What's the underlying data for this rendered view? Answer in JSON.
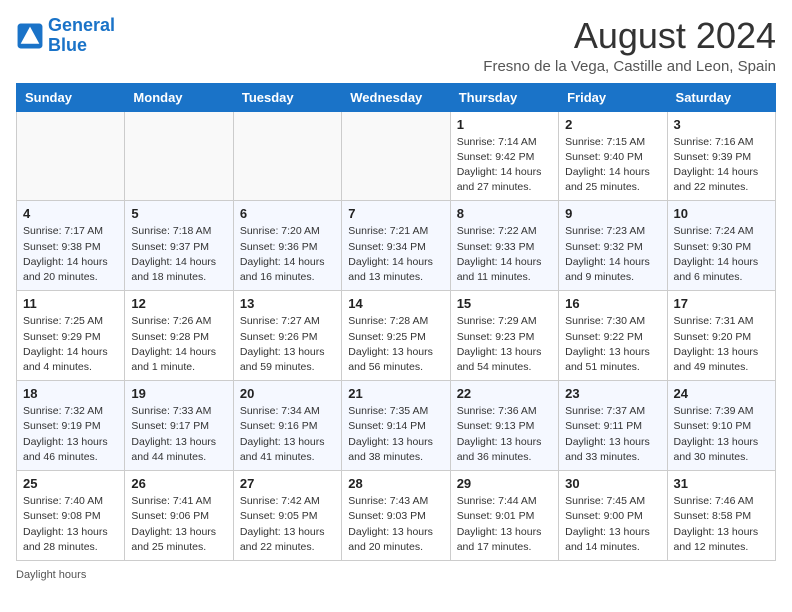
{
  "header": {
    "logo_line1": "General",
    "logo_line2": "Blue",
    "month_year": "August 2024",
    "location": "Fresno de la Vega, Castille and Leon, Spain"
  },
  "days_of_week": [
    "Sunday",
    "Monday",
    "Tuesday",
    "Wednesday",
    "Thursday",
    "Friday",
    "Saturday"
  ],
  "weeks": [
    [
      {
        "day": "",
        "info": ""
      },
      {
        "day": "",
        "info": ""
      },
      {
        "day": "",
        "info": ""
      },
      {
        "day": "",
        "info": ""
      },
      {
        "day": "1",
        "info": "Sunrise: 7:14 AM\nSunset: 9:42 PM\nDaylight: 14 hours and 27 minutes."
      },
      {
        "day": "2",
        "info": "Sunrise: 7:15 AM\nSunset: 9:40 PM\nDaylight: 14 hours and 25 minutes."
      },
      {
        "day": "3",
        "info": "Sunrise: 7:16 AM\nSunset: 9:39 PM\nDaylight: 14 hours and 22 minutes."
      }
    ],
    [
      {
        "day": "4",
        "info": "Sunrise: 7:17 AM\nSunset: 9:38 PM\nDaylight: 14 hours and 20 minutes."
      },
      {
        "day": "5",
        "info": "Sunrise: 7:18 AM\nSunset: 9:37 PM\nDaylight: 14 hours and 18 minutes."
      },
      {
        "day": "6",
        "info": "Sunrise: 7:20 AM\nSunset: 9:36 PM\nDaylight: 14 hours and 16 minutes."
      },
      {
        "day": "7",
        "info": "Sunrise: 7:21 AM\nSunset: 9:34 PM\nDaylight: 14 hours and 13 minutes."
      },
      {
        "day": "8",
        "info": "Sunrise: 7:22 AM\nSunset: 9:33 PM\nDaylight: 14 hours and 11 minutes."
      },
      {
        "day": "9",
        "info": "Sunrise: 7:23 AM\nSunset: 9:32 PM\nDaylight: 14 hours and 9 minutes."
      },
      {
        "day": "10",
        "info": "Sunrise: 7:24 AM\nSunset: 9:30 PM\nDaylight: 14 hours and 6 minutes."
      }
    ],
    [
      {
        "day": "11",
        "info": "Sunrise: 7:25 AM\nSunset: 9:29 PM\nDaylight: 14 hours and 4 minutes."
      },
      {
        "day": "12",
        "info": "Sunrise: 7:26 AM\nSunset: 9:28 PM\nDaylight: 14 hours and 1 minute."
      },
      {
        "day": "13",
        "info": "Sunrise: 7:27 AM\nSunset: 9:26 PM\nDaylight: 13 hours and 59 minutes."
      },
      {
        "day": "14",
        "info": "Sunrise: 7:28 AM\nSunset: 9:25 PM\nDaylight: 13 hours and 56 minutes."
      },
      {
        "day": "15",
        "info": "Sunrise: 7:29 AM\nSunset: 9:23 PM\nDaylight: 13 hours and 54 minutes."
      },
      {
        "day": "16",
        "info": "Sunrise: 7:30 AM\nSunset: 9:22 PM\nDaylight: 13 hours and 51 minutes."
      },
      {
        "day": "17",
        "info": "Sunrise: 7:31 AM\nSunset: 9:20 PM\nDaylight: 13 hours and 49 minutes."
      }
    ],
    [
      {
        "day": "18",
        "info": "Sunrise: 7:32 AM\nSunset: 9:19 PM\nDaylight: 13 hours and 46 minutes."
      },
      {
        "day": "19",
        "info": "Sunrise: 7:33 AM\nSunset: 9:17 PM\nDaylight: 13 hours and 44 minutes."
      },
      {
        "day": "20",
        "info": "Sunrise: 7:34 AM\nSunset: 9:16 PM\nDaylight: 13 hours and 41 minutes."
      },
      {
        "day": "21",
        "info": "Sunrise: 7:35 AM\nSunset: 9:14 PM\nDaylight: 13 hours and 38 minutes."
      },
      {
        "day": "22",
        "info": "Sunrise: 7:36 AM\nSunset: 9:13 PM\nDaylight: 13 hours and 36 minutes."
      },
      {
        "day": "23",
        "info": "Sunrise: 7:37 AM\nSunset: 9:11 PM\nDaylight: 13 hours and 33 minutes."
      },
      {
        "day": "24",
        "info": "Sunrise: 7:39 AM\nSunset: 9:10 PM\nDaylight: 13 hours and 30 minutes."
      }
    ],
    [
      {
        "day": "25",
        "info": "Sunrise: 7:40 AM\nSunset: 9:08 PM\nDaylight: 13 hours and 28 minutes."
      },
      {
        "day": "26",
        "info": "Sunrise: 7:41 AM\nSunset: 9:06 PM\nDaylight: 13 hours and 25 minutes."
      },
      {
        "day": "27",
        "info": "Sunrise: 7:42 AM\nSunset: 9:05 PM\nDaylight: 13 hours and 22 minutes."
      },
      {
        "day": "28",
        "info": "Sunrise: 7:43 AM\nSunset: 9:03 PM\nDaylight: 13 hours and 20 minutes."
      },
      {
        "day": "29",
        "info": "Sunrise: 7:44 AM\nSunset: 9:01 PM\nDaylight: 13 hours and 17 minutes."
      },
      {
        "day": "30",
        "info": "Sunrise: 7:45 AM\nSunset: 9:00 PM\nDaylight: 13 hours and 14 minutes."
      },
      {
        "day": "31",
        "info": "Sunrise: 7:46 AM\nSunset: 8:58 PM\nDaylight: 13 hours and 12 minutes."
      }
    ]
  ],
  "footer": {
    "note": "Daylight hours"
  }
}
